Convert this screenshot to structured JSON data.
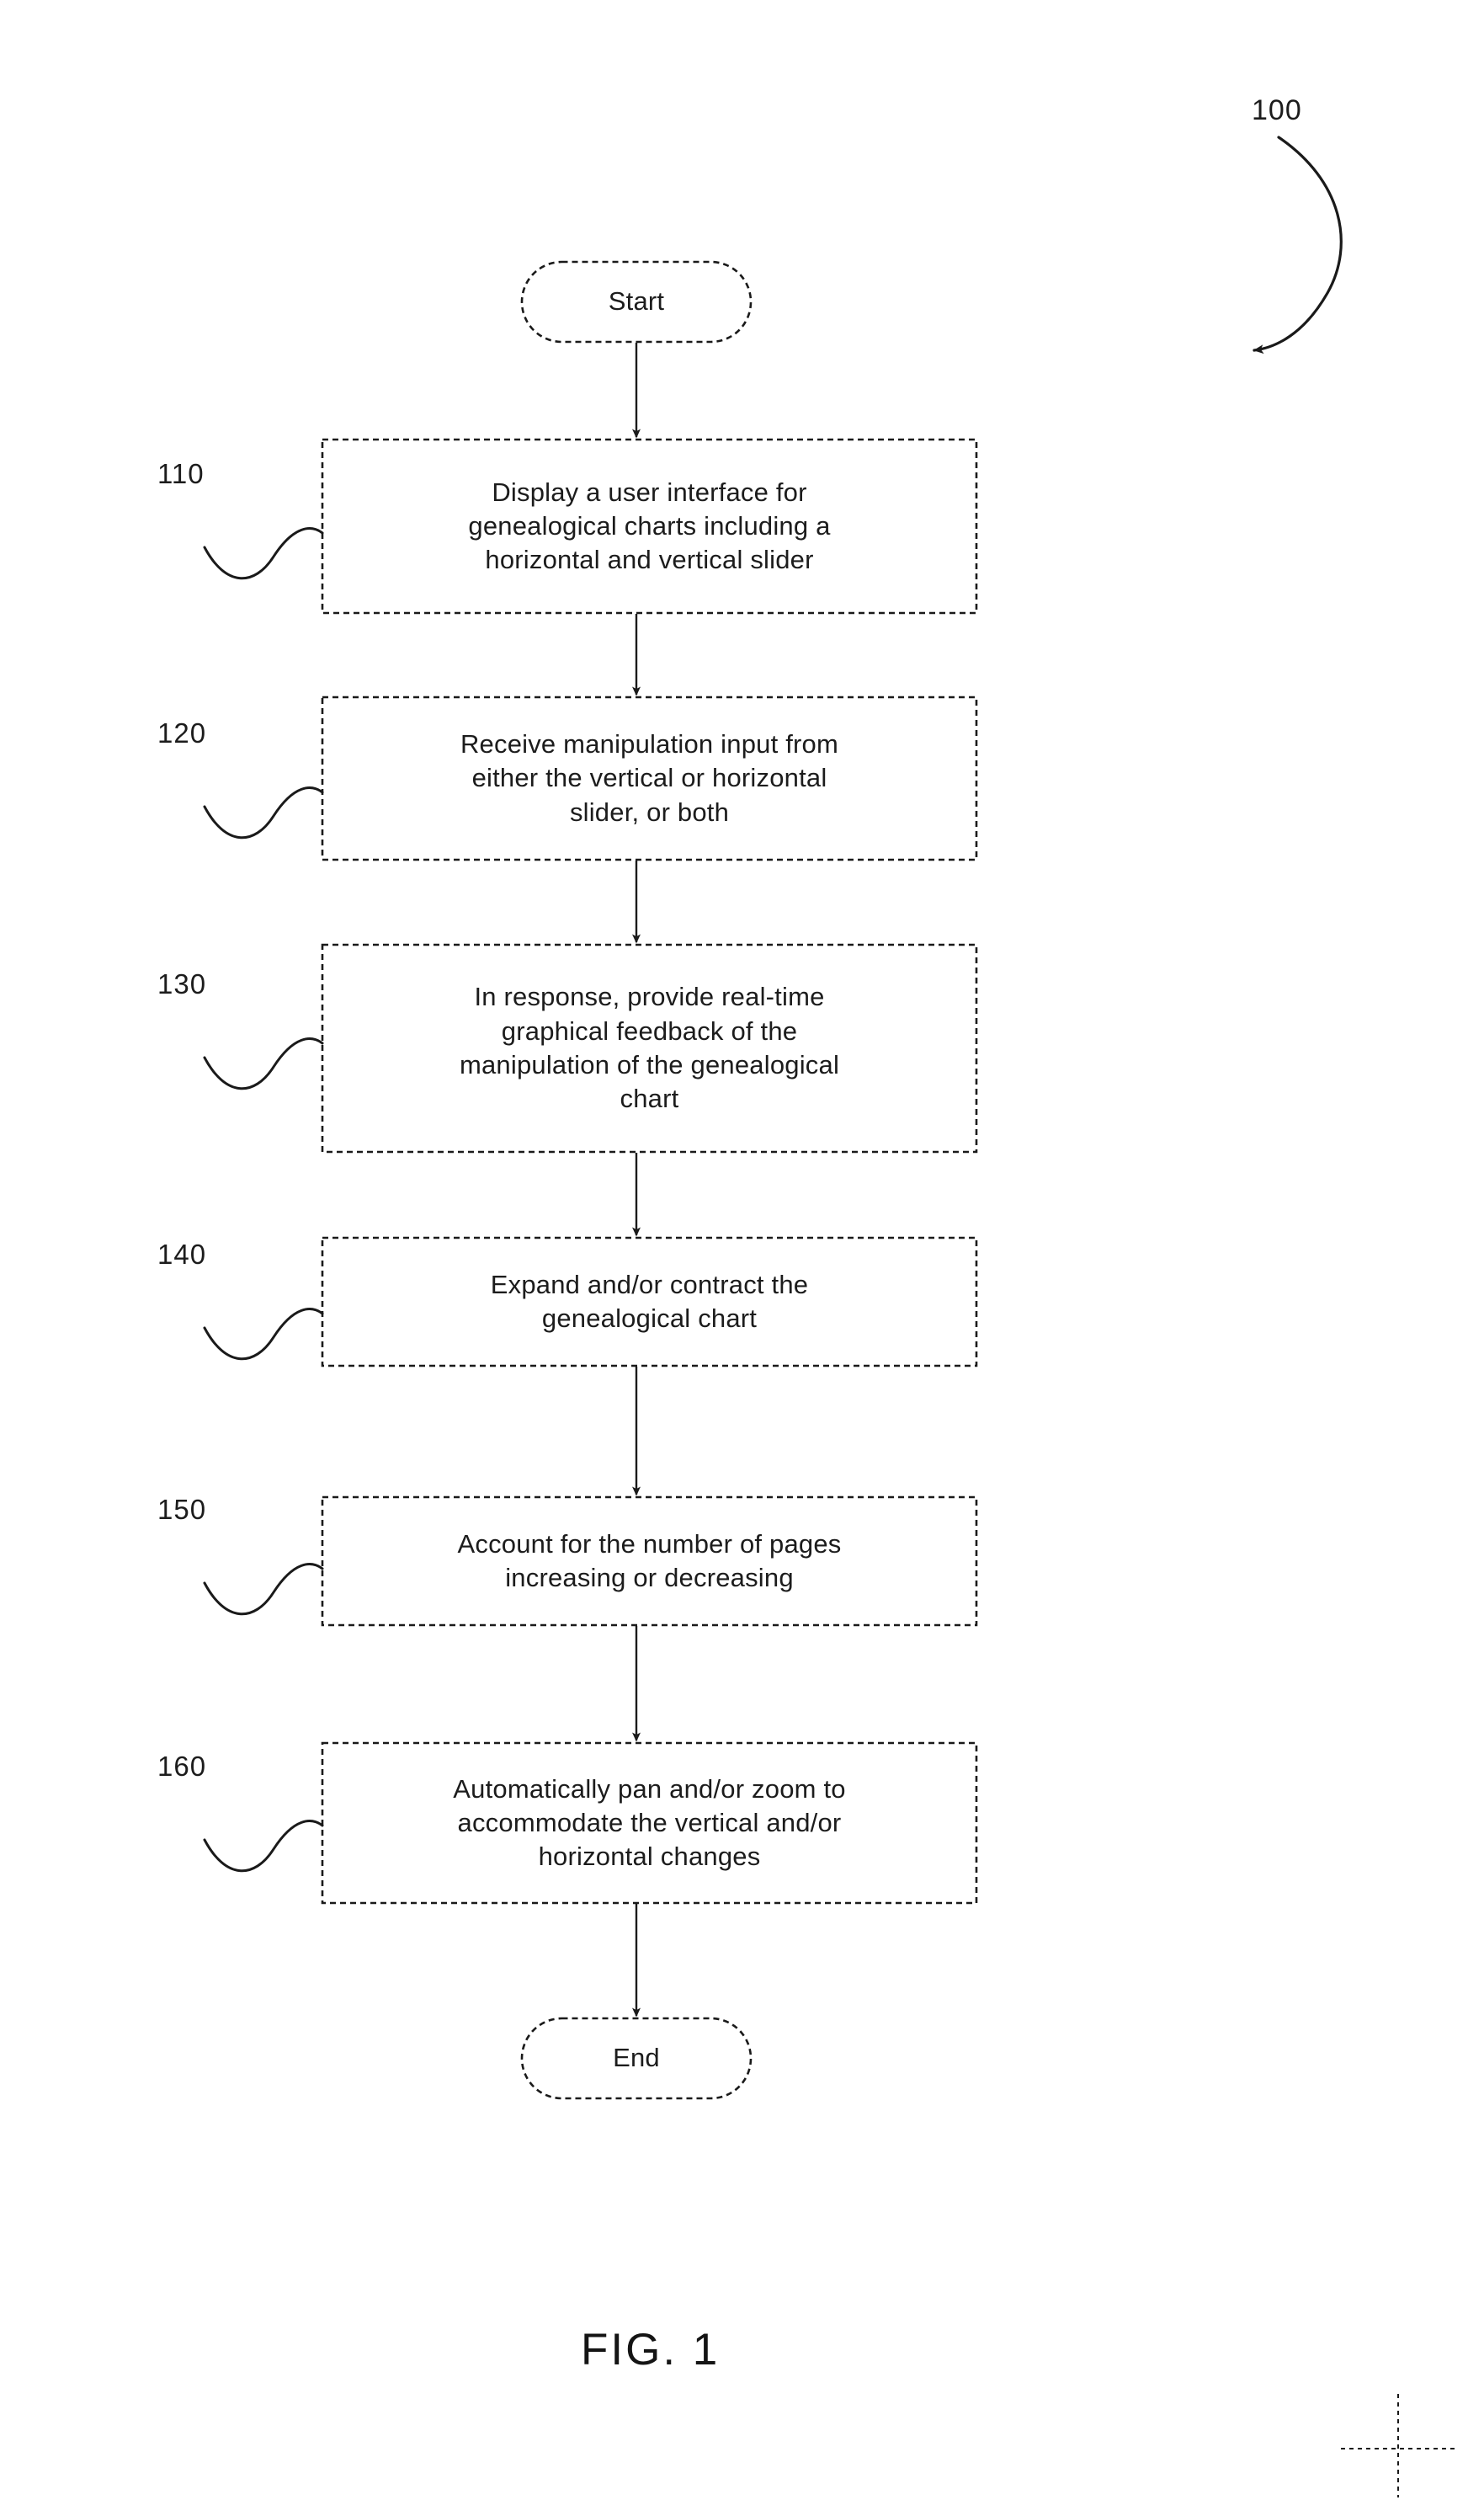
{
  "figure": {
    "caption": "FIG. 1",
    "diagram_reference": "100",
    "type": "flowchart",
    "orientation": "vertical",
    "border_style": "dashed",
    "line_color": "#1a1a1a",
    "background_color": "#ffffff"
  },
  "nodes": [
    {
      "id": "start",
      "shape": "oval",
      "reference": "",
      "lines": [
        "Start"
      ]
    },
    {
      "id": "step-110",
      "shape": "rectangle",
      "reference": "110",
      "lines": [
        "Display a user interface for",
        "genealogical charts including a",
        "horizontal and vertical slider"
      ]
    },
    {
      "id": "step-120",
      "shape": "rectangle",
      "reference": "120",
      "lines": [
        "Receive manipulation input from",
        "either the vertical or horizontal",
        "slider, or both"
      ]
    },
    {
      "id": "step-130",
      "shape": "rectangle",
      "reference": "130",
      "lines": [
        "In response, provide real-time",
        "graphical feedback of the",
        "manipulation of the genealogical",
        "chart"
      ]
    },
    {
      "id": "step-140",
      "shape": "rectangle",
      "reference": "140",
      "lines": [
        "Expand and/or contract the",
        "genealogical chart"
      ]
    },
    {
      "id": "step-150",
      "shape": "rectangle",
      "reference": "150",
      "lines": [
        "Account for the number of pages",
        "increasing or decreasing"
      ]
    },
    {
      "id": "step-160",
      "shape": "rectangle",
      "reference": "160",
      "lines": [
        "Automatically pan and/or zoom to",
        "accommodate the vertical and/or",
        "horizontal changes"
      ]
    },
    {
      "id": "end",
      "shape": "oval",
      "reference": "",
      "lines": [
        "End"
      ]
    }
  ],
  "edges": [
    {
      "from": "start",
      "to": "step-110",
      "style": "solid-arrow"
    },
    {
      "from": "step-110",
      "to": "step-120",
      "style": "solid-arrow"
    },
    {
      "from": "step-120",
      "to": "step-130",
      "style": "solid-arrow"
    },
    {
      "from": "step-130",
      "to": "step-140",
      "style": "solid-arrow"
    },
    {
      "from": "step-140",
      "to": "step-150",
      "style": "solid-arrow"
    },
    {
      "from": "step-150",
      "to": "step-160",
      "style": "solid-arrow"
    },
    {
      "from": "step-160",
      "to": "end",
      "style": "solid-arrow"
    }
  ],
  "annotations": {
    "registration_mark": "crosshair"
  }
}
